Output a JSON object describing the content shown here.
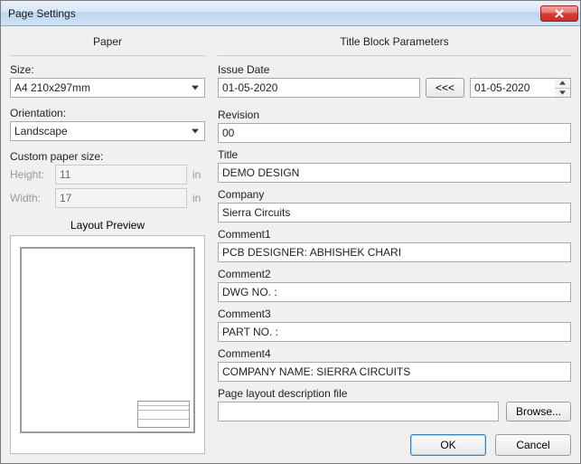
{
  "window": {
    "title": "Page Settings"
  },
  "sections": {
    "paper": "Paper",
    "tbp": "Title Block Parameters"
  },
  "paper": {
    "size_label": "Size:",
    "size_value": "A4 210x297mm",
    "orientation_label": "Orientation:",
    "orientation_value": "Landscape",
    "custom_label": "Custom paper size:",
    "height_label": "Height:",
    "height_value": "11",
    "width_label": "Width:",
    "width_value": "17",
    "unit": "in",
    "preview_label": "Layout Preview"
  },
  "tbp": {
    "issue_date_label": "Issue Date",
    "issue_date_value": "01-05-2020",
    "copy_btn": "<<<",
    "date_right": "01-05-2020",
    "revision_label": "Revision",
    "revision_value": "00",
    "title_label": "Title",
    "title_value": "DEMO DESIGN",
    "company_label": "Company",
    "company_value": "Sierra Circuits",
    "c1_label": "Comment1",
    "c1_value": "PCB DESIGNER: ABHISHEK CHARI",
    "c2_label": "Comment2",
    "c2_value": "DWG NO. :",
    "c3_label": "Comment3",
    "c3_value": "PART NO. :",
    "c4_label": "Comment4",
    "c4_value": "COMPANY NAME: SIERRA CIRCUITS",
    "layoutfile_label": "Page layout description file",
    "layoutfile_value": "",
    "browse_btn": "Browse..."
  },
  "footer": {
    "ok": "OK",
    "cancel": "Cancel"
  }
}
